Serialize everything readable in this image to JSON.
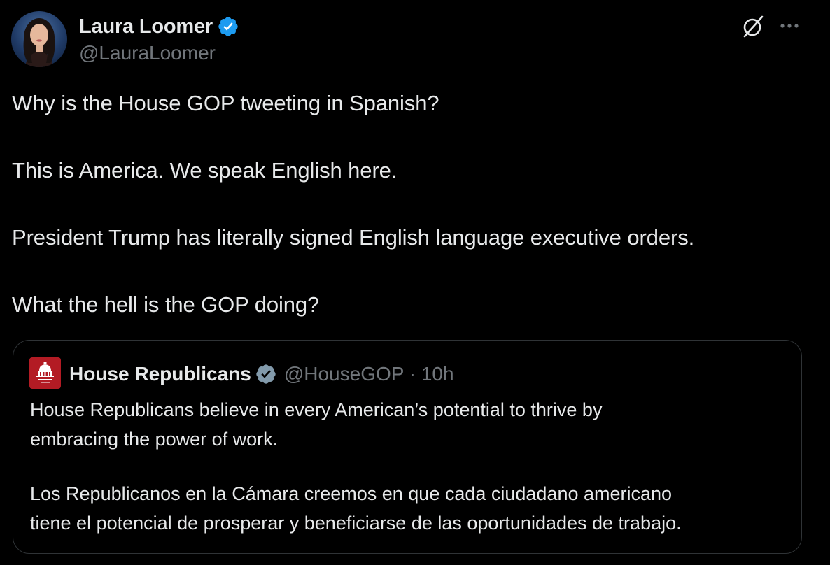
{
  "author": {
    "display_name": "Laura Loomer",
    "handle": "@LauraLoomer",
    "verified": true
  },
  "header_icons": [
    "grok-icon",
    "more-icon"
  ],
  "tweet": {
    "lines": [
      "Why is the House GOP tweeting in Spanish?",
      "This is America. We speak English here.",
      "President Trump has literally signed English language executive orders.",
      "What the hell is the GOP doing?"
    ]
  },
  "quoted": {
    "display_name": "House Republicans",
    "handle_time": "@HouseGOP · 10h",
    "verified": true,
    "lines": [
      "House Republicans believe in every American’s potential to thrive by",
      "embracing the power of work.",
      "Los Republicanos en la Cámara creemos en que cada ciudadano americano",
      "tiene el potencial de prosperar y beneficiarse de las oportunidades de trabajo."
    ]
  },
  "colors": {
    "background": "#000000",
    "text_primary": "#e7e9ea",
    "text_secondary": "#71767b",
    "verified_blue": "#1d9bf0",
    "verified_gray": "#829aab",
    "border": "#2f3336",
    "gop_red": "#b31b24"
  }
}
